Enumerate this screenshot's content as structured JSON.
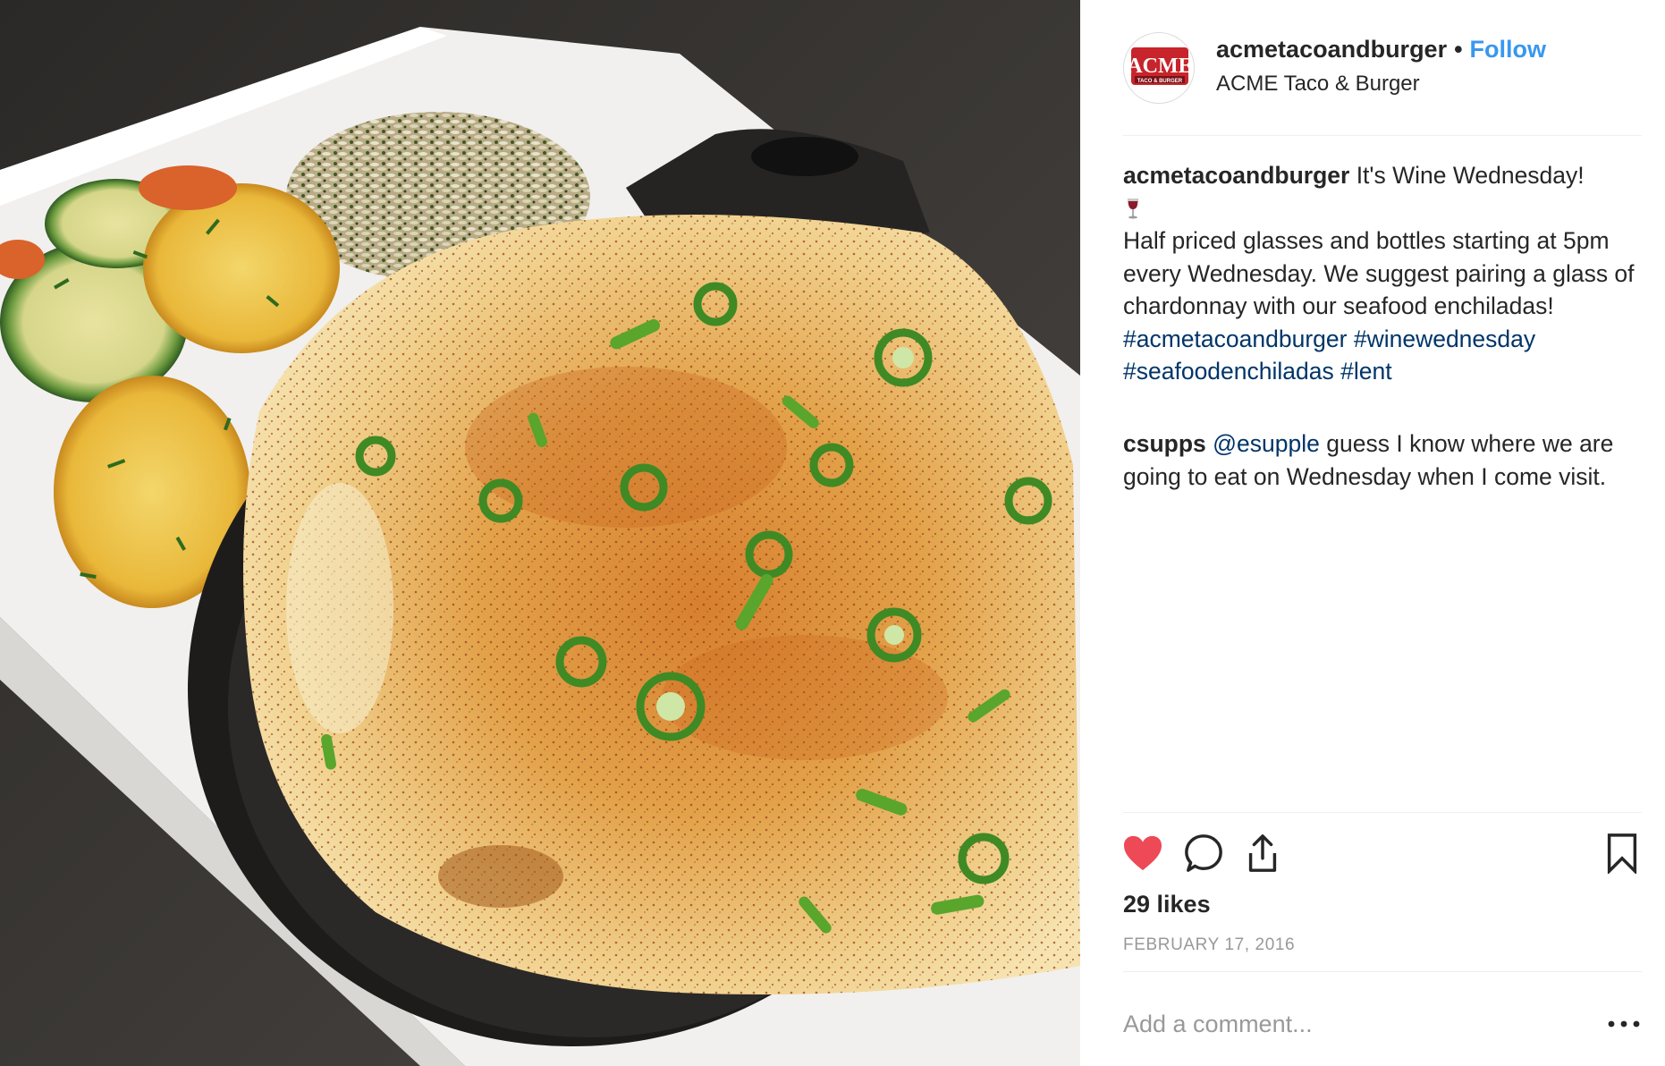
{
  "post": {
    "photo_alt": "Seafood enchiladas in a cast-iron skillet with zucchini, squash and rice",
    "avatar": {
      "logo_top": "ACME",
      "logo_bottom": "TACO & BURGER",
      "logo_color": "#c8242b"
    },
    "header": {
      "username": "acmetacoandburger",
      "separator": "•",
      "follow_label": "Follow",
      "location": "ACME Taco & Burger"
    },
    "caption": {
      "username": "acmetacoandburger",
      "text_line1": "It's Wine Wednesday!",
      "emoji_icon": "wine-glass-icon",
      "body": "Half priced glasses and bottles starting at 5pm every Wednesday. We suggest pairing a glass of chardonnay with our seafood enchiladas!",
      "hashtags": [
        "#acmetacoandburger",
        "#winewednesday",
        "#seafoodenchiladas",
        "#lent"
      ]
    },
    "comments": [
      {
        "username": "csupps",
        "mention": "@esupple",
        "text": "guess I know where we are going to eat on Wednesday when I come visit."
      }
    ],
    "actions": {
      "like_icon": "heart-filled-icon",
      "comment_icon": "speech-bubble-icon",
      "share_icon": "share-icon",
      "save_icon": "bookmark-icon",
      "like_color": "#ed4956"
    },
    "likes": "29 likes",
    "date": "FEBRUARY 17, 2016",
    "add_comment": {
      "placeholder": "Add a comment...",
      "more_icon": "more-options-icon"
    },
    "colors": {
      "link": "#003569",
      "follow": "#3897f0",
      "muted": "#999999",
      "text": "#262626"
    }
  }
}
